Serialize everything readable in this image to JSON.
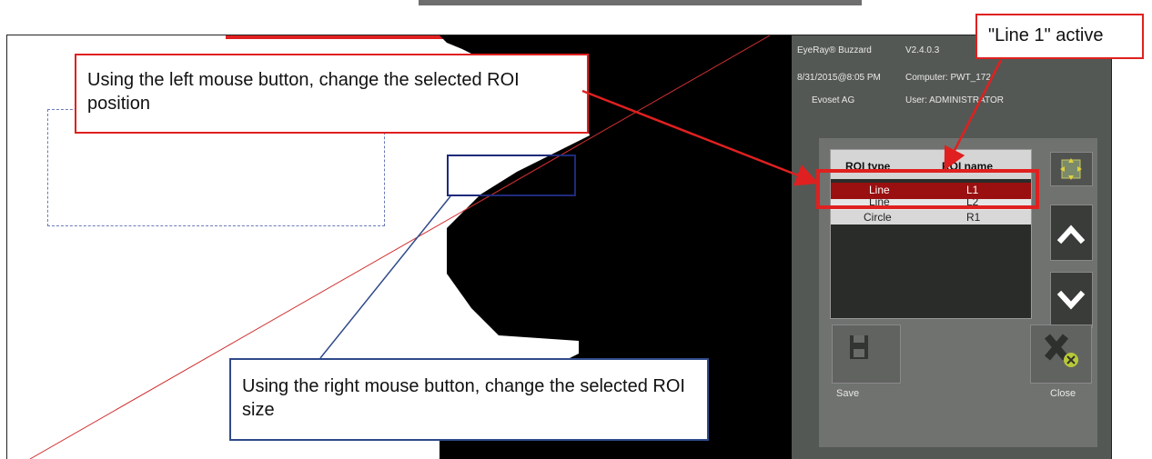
{
  "app": {
    "name": "EyeRay® Buzzard",
    "version": "V2.4.0.3",
    "datetime": "8/31/2015@8:05 PM",
    "computer": "Computer: PWT_172",
    "company": "Evoset AG",
    "user": "User: ADMINISTRATOR"
  },
  "roi_table": {
    "headers": {
      "type": "ROI type",
      "name": "ROI name"
    },
    "rows": [
      {
        "type": "Line",
        "name": "L1",
        "selected": true
      },
      {
        "type": "Line",
        "name": "L2",
        "selected": false
      },
      {
        "type": "Circle",
        "name": "R1",
        "selected": false
      }
    ]
  },
  "buttons": {
    "save": "Save",
    "close": "Close"
  },
  "callouts": {
    "left_mouse": "Using the left mouse button, change the selected ROI position",
    "right_mouse": "Using the right mouse button, change the selected ROI size",
    "active": "\"Line 1\" active"
  },
  "colors": {
    "highlight_red": "#e02020",
    "selected_row": "#9a1010",
    "roi_box": "#1f2a7a",
    "panel_bg": "#545854"
  },
  "icons": [
    "move-arrows-icon",
    "chevron-up-icon",
    "chevron-down-icon",
    "floppy-disk-icon",
    "close-x-icon"
  ]
}
